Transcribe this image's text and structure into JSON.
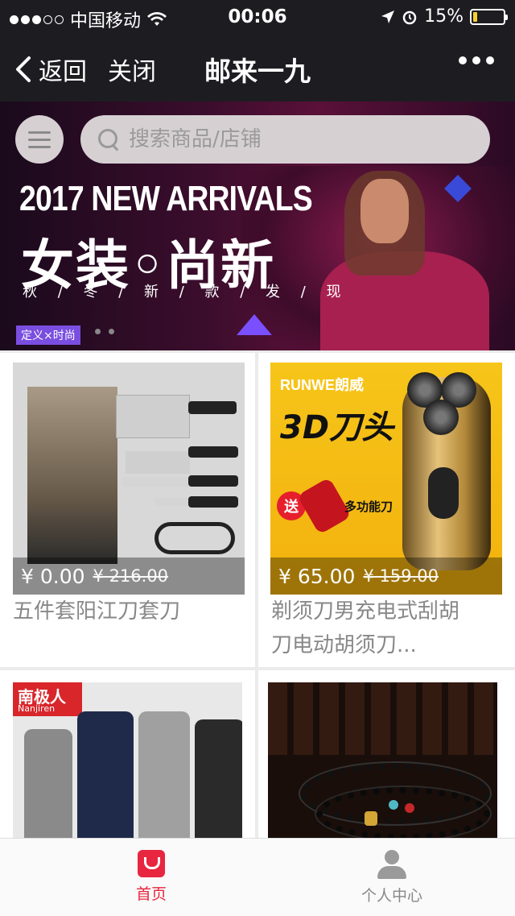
{
  "status_bar": {
    "carrier": "中国移动",
    "time": "00:06",
    "battery": "15%",
    "battery_level": 0.15,
    "signal_icon": "signal-dots-icon",
    "wifi_icon": "wifi-icon",
    "location_icon": "location-arrow-icon",
    "alarm_icon": "alarm-icon"
  },
  "nav": {
    "back": "返回",
    "close": "关闭",
    "title": "邮来一九",
    "more_icon": "more-dots-icon"
  },
  "banner": {
    "search_placeholder": "搜索商品/店铺",
    "headline": "2017 NEW ARRIVALS",
    "subheadline": "女装◦尚新",
    "tagline": "秋 / 冬 / 新 / 款 / 发 / 现",
    "tag": "定义×时尚",
    "colors": {
      "bg": "#3b0d2c",
      "accent": "#7a4ee0"
    }
  },
  "products": [
    {
      "name": "五件套阳江刀套刀",
      "price": "¥ 0.00",
      "original_price": "¥ 216.00"
    },
    {
      "name": "剃须刀男充电式刮胡刀电动胡须刀...",
      "price": "¥ 65.00",
      "original_price": "¥ 159.00",
      "image_brand": "RUNWE朗威",
      "image_title": "3D刀头",
      "image_gift": "送",
      "image_gift_label": "多功能刀"
    },
    {
      "name": "",
      "image_brand": "南极人",
      "image_brand_en": "Nanjiren"
    },
    {
      "name": ""
    }
  ],
  "tabbar": {
    "home": "首页",
    "profile": "个人中心",
    "active_color": "#e8263f"
  }
}
